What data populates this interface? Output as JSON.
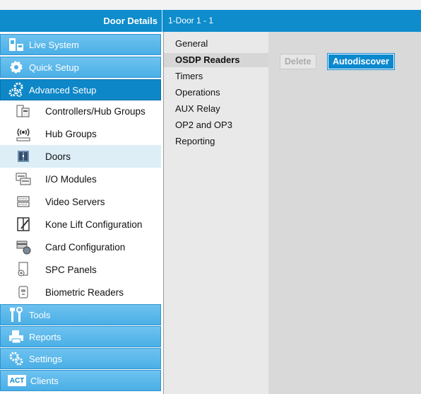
{
  "header": {
    "title": "Door Details",
    "breadcrumb": "1-Door 1 - 1"
  },
  "sidebar": {
    "sections_top": [
      {
        "label": "Live System",
        "icon": "live-system-icon"
      },
      {
        "label": "Quick Setup",
        "icon": "gear-icon"
      },
      {
        "label": "Advanced Setup",
        "icon": "gears-icon",
        "active": true
      }
    ],
    "items": [
      {
        "label": "Controllers/Hub Groups",
        "icon": "controller-icon"
      },
      {
        "label": "Hub Groups",
        "icon": "hub-icon"
      },
      {
        "label": "Doors",
        "icon": "door-icon",
        "selected": true
      },
      {
        "label": "I/O Modules",
        "icon": "io-module-icon"
      },
      {
        "label": "Video Servers",
        "icon": "video-server-icon"
      },
      {
        "label": "Kone Lift Configuration",
        "icon": "lift-icon"
      },
      {
        "label": "Card Configuration",
        "icon": "card-icon"
      },
      {
        "label": "SPC Panels",
        "icon": "spc-panel-icon"
      },
      {
        "label": "Biometric Readers",
        "icon": "biometric-icon"
      }
    ],
    "sections_bottom": [
      {
        "label": "Tools",
        "icon": "tools-icon"
      },
      {
        "label": "Reports",
        "icon": "printer-icon"
      },
      {
        "label": "Settings",
        "icon": "settings-icon"
      },
      {
        "label": "Clients",
        "icon": "act-logo-icon",
        "logo_text": "ACT"
      }
    ]
  },
  "menu": {
    "items": [
      "General",
      "OSDP Readers",
      "Timers",
      "Operations",
      "AUX Relay",
      "OP2 and OP3",
      "Reporting"
    ],
    "active_index": 1
  },
  "toolbar": {
    "delete_label": "Delete",
    "autodiscover_label": "Autodiscover"
  },
  "colors": {
    "header": "#0e8ccc",
    "section": "#4aafe6",
    "section_active": "#0d87c8",
    "selected_row": "#ddeef7",
    "button": "#0b89cf"
  }
}
